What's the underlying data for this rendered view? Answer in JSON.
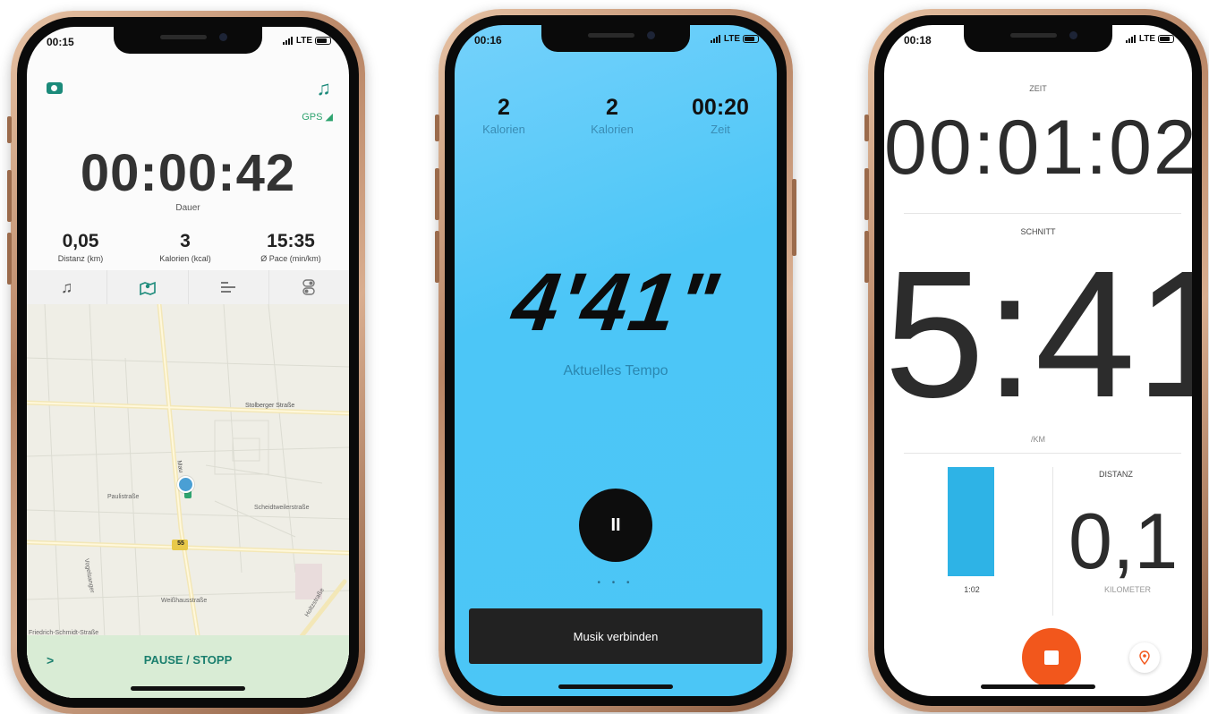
{
  "phone1": {
    "status_time": "00:15",
    "status_network": "LTE",
    "gps_label": "GPS",
    "timer": "00:00:42",
    "timer_label": "Dauer",
    "stats": [
      {
        "value": "0,05",
        "label": "Distanz (km)"
      },
      {
        "value": "3",
        "label": "Kalorien (kcal)"
      },
      {
        "value": "15:35",
        "label": "Ø Pace (min/km)"
      }
    ],
    "tabs": [
      "music-icon",
      "map-icon",
      "list-icon",
      "toggle-icon"
    ],
    "map_labels": {
      "street1": "Stolberger Straße",
      "street2": "Paulistraße",
      "street3": "Scheidtweilerstraße",
      "street4": "Weißhausstraße",
      "street5": "Friedrich-Schmidt-Straße",
      "street6": "Vogelsanger",
      "street7": "Holtzstraße",
      "street8": "Mau",
      "road_badge": "55"
    },
    "bottom_chevron": ">",
    "bottom_label": "PAUSE / STOPP"
  },
  "phone2": {
    "status_time": "00:16",
    "status_network": "LTE",
    "top_stats": [
      {
        "value": "2",
        "label": "Kalorien"
      },
      {
        "value": "2",
        "label": "Kalorien"
      },
      {
        "value": "00:20",
        "label": "Zeit"
      }
    ],
    "pace": "4'41\"",
    "pace_label": "Aktuelles Tempo",
    "pause_symbol": "II",
    "page_dots": "• • •",
    "music_button": "Musik verbinden"
  },
  "phone3": {
    "status_time": "00:18",
    "status_network": "LTE",
    "zeit_label": "ZEIT",
    "clock": "00:01:02",
    "schnitt_label": "SCHNITT",
    "avg_pace": "5:41",
    "unit_label": "/KM",
    "bar_label": "1:02",
    "distanz_label": "DISTANZ",
    "distance": "0,1",
    "distance_unit": "KILOMETER",
    "stop_button": "stop-icon",
    "location_button": "location-pin-icon"
  },
  "colors": {
    "teal": "#1b8a7a",
    "sky_blue": "#4bc6f6",
    "orange": "#f2571c",
    "bar_blue": "#2eb3e6"
  }
}
